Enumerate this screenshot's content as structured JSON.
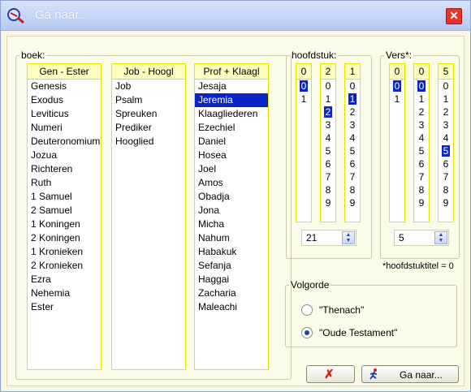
{
  "window": {
    "title": "Ga naar...",
    "close_glyph": "✕"
  },
  "books": {
    "legend": "boek:",
    "columns": [
      {
        "header": "Gen - Ester",
        "items": [
          "Genesis",
          "Exodus",
          "Leviticus",
          "Numeri",
          "Deuteronomium",
          "Jozua",
          "Richteren",
          "Ruth",
          "1 Samuel",
          "2 Samuel",
          "1 Koningen",
          "2 Koningen",
          "1 Kronieken",
          "2 Kronieken",
          "Ezra",
          "Nehemia",
          "Ester"
        ]
      },
      {
        "header": "Job - Hoogl",
        "items": [
          "Job",
          "Psalm",
          "Spreuken",
          "Prediker",
          "Hooglied"
        ]
      },
      {
        "header": "Prof + Klaagl",
        "items": [
          "Jesaja",
          "Jeremia",
          "Klaagliederen",
          "Ezechiel",
          "Daniel",
          "Hosea",
          "Joel",
          "Amos",
          "Obadja",
          "Jona",
          "Micha",
          "Nahum",
          "Habakuk",
          "Sefanja",
          "Haggai",
          "Zacharia",
          "Maleachi"
        ],
        "selected": "Jeremia"
      }
    ]
  },
  "chapter": {
    "legend": "hoofdstuk:",
    "value": "21",
    "columns": [
      {
        "header": "0",
        "digits": [
          "0",
          "1"
        ],
        "selected": "0"
      },
      {
        "header": "2",
        "digits": [
          "0",
          "1",
          "2",
          "3",
          "4",
          "5",
          "6",
          "7",
          "8",
          "9"
        ],
        "selected": "2"
      },
      {
        "header": "1",
        "digits": [
          "0",
          "1",
          "2",
          "3",
          "4",
          "5",
          "6",
          "7",
          "8",
          "9"
        ],
        "selected": "1"
      }
    ]
  },
  "verse": {
    "legend": "Vers*:",
    "value": "5",
    "columns": [
      {
        "header": "0",
        "digits": [
          "0",
          "1"
        ],
        "selected": "0"
      },
      {
        "header": "0",
        "digits": [
          "0",
          "1",
          "2",
          "3",
          "4",
          "5",
          "6",
          "7",
          "8",
          "9"
        ],
        "selected": "0"
      },
      {
        "header": "5",
        "digits": [
          "0",
          "1",
          "2",
          "3",
          "4",
          "5",
          "6",
          "7",
          "8",
          "9"
        ],
        "selected": "5"
      }
    ]
  },
  "note": "*hoofdstuktitel = 0",
  "order": {
    "legend": "Volgorde",
    "options": [
      {
        "label": "\"Thenach\"",
        "checked": false
      },
      {
        "label": "\"Oude Testament\"",
        "checked": true
      }
    ]
  },
  "buttons": {
    "cancel_glyph": "✗",
    "goto_label": "Ga naar..."
  },
  "colors": {
    "selection": "#0a24c8",
    "list_border": "#e6e600",
    "header_bg": "#fefec0"
  }
}
